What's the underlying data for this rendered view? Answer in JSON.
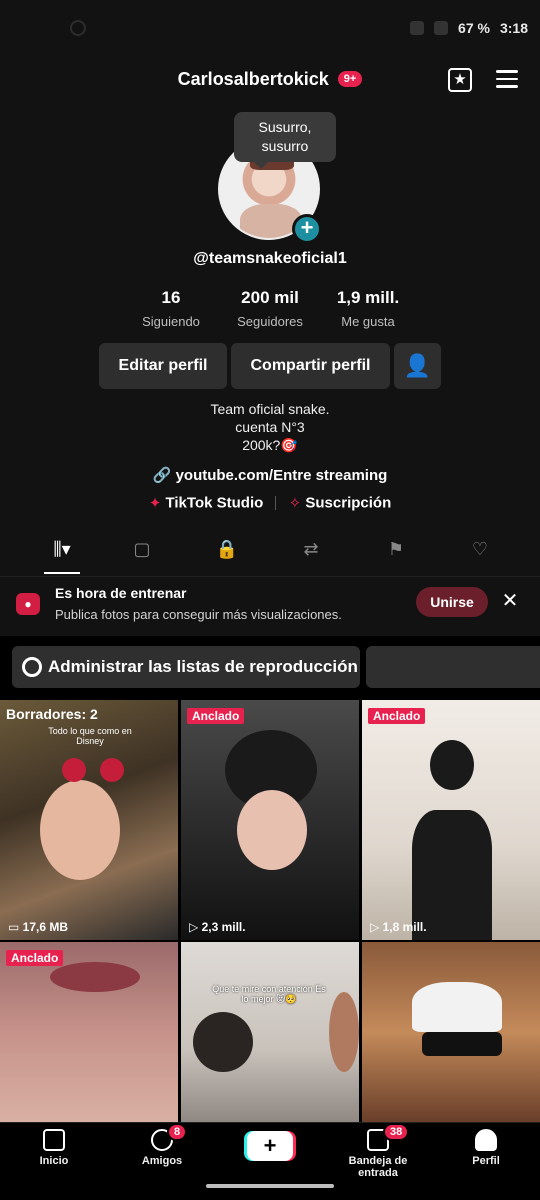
{
  "status": {
    "battery": "67 %",
    "time": "3:18"
  },
  "header": {
    "username": "Carlosalbertokick",
    "notif_badge": "9+"
  },
  "profile": {
    "tooltip": "Susurro, susurro",
    "handle": "@teamsnakeoficial1",
    "stats": [
      {
        "num": "16",
        "label": "Siguiendo"
      },
      {
        "num": "200 mil",
        "label": "Seguidores"
      },
      {
        "num": "1,9 mill.",
        "label": "Me gusta"
      }
    ],
    "buttons": {
      "edit": "Editar perfil",
      "share": "Compartir perfil"
    },
    "bio": [
      "Team oficial snake.",
      "cuenta N°3",
      "200k?🎯"
    ],
    "link": "youtube.com/Entre streaming",
    "studio": "TikTok Studio",
    "subscription": "Suscripción"
  },
  "banner": {
    "title": "Es hora de entrenar",
    "subtitle": "Publica fotos para conseguir más visualizaciones.",
    "join_label": "Unirse",
    "close_label": "✕"
  },
  "playlist": {
    "label": "Administrar las listas de reproducción"
  },
  "grid": {
    "items": [
      {
        "tag": "Borradores: 2",
        "caption": "Todo lo que como en Disney",
        "meta": "17,6 MB"
      },
      {
        "tag": "Anclado",
        "meta": "2,3 mill."
      },
      {
        "tag": "Anclado",
        "meta": "1,8 mill."
      },
      {
        "tag": "Anclado"
      },
      {
        "caption": "Que te mire con atención Es lo mejor 😻🥺"
      },
      {}
    ]
  },
  "nav": {
    "home": "Inicio",
    "friends": "Amigos",
    "friends_count": "8",
    "create": "+",
    "inbox": "Bandeja de entrada",
    "inbox_count": "38",
    "profile": "Perfil"
  }
}
